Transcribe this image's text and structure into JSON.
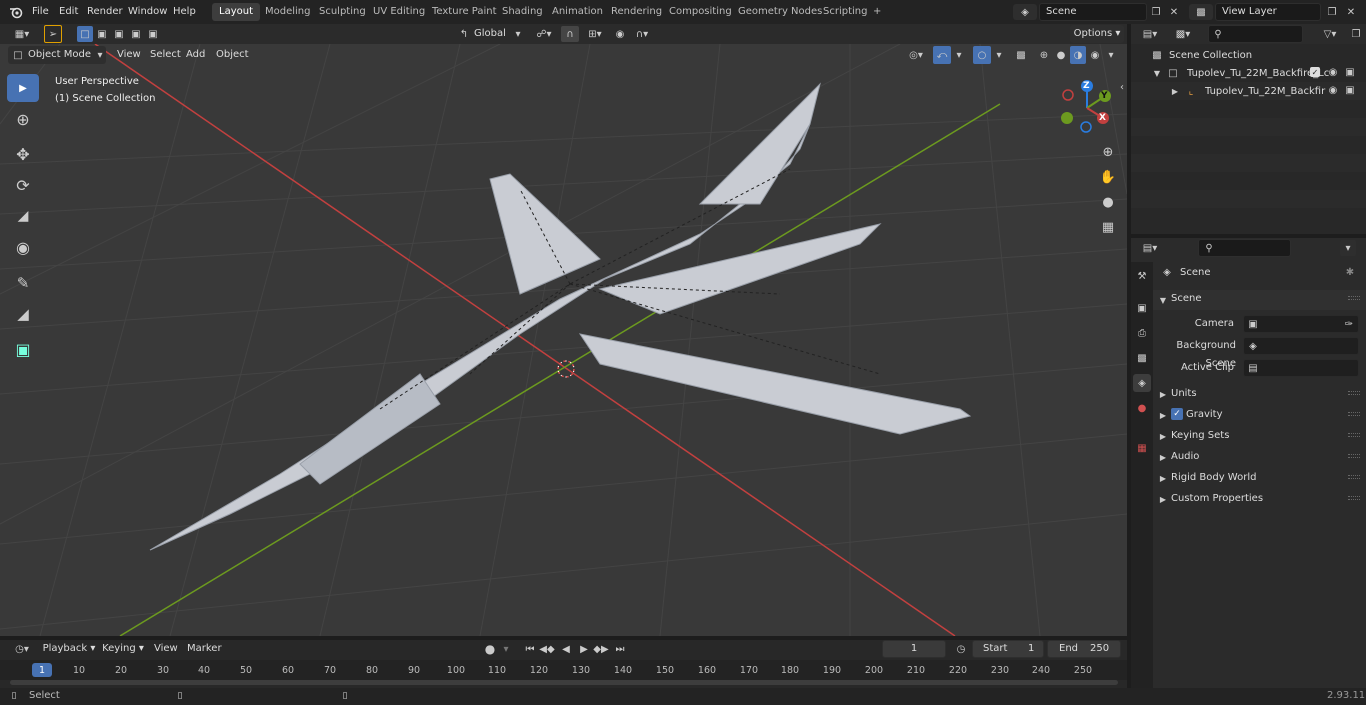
{
  "menu": [
    "File",
    "Edit",
    "Render",
    "Window",
    "Help"
  ],
  "workspaces": [
    "Layout",
    "Modeling",
    "Sculpting",
    "UV Editing",
    "Texture Paint",
    "Shading",
    "Animation",
    "Rendering",
    "Compositing",
    "Geometry Nodes",
    "Scripting"
  ],
  "scene_name": "Scene",
  "view_layer": "View Layer",
  "header": {
    "mode": "Object Mode",
    "view": "View",
    "select": "Select",
    "add": "Add",
    "object": "Object",
    "transform": "Global",
    "options": "Options"
  },
  "viewport": {
    "perspective": "User Perspective",
    "collection": "(1) Scene Collection",
    "gizmo": {
      "x": "X",
      "y": "Y",
      "z": "Z"
    }
  },
  "outliner": {
    "root": "Scene Collection",
    "collection": "Tupolev_Tu_22M_Backfire_Lc",
    "object": "Tupolev_Tu_22M_Backfir"
  },
  "properties": {
    "title": "Scene",
    "section": "Scene",
    "camera_label": "Camera",
    "bg_label": "Background Scene",
    "clip_label": "Active Clip",
    "panels": [
      "Units",
      "Gravity",
      "Keying Sets",
      "Audio",
      "Rigid Body World",
      "Custom Properties"
    ]
  },
  "timeline": {
    "playback": "Playback",
    "keying": "Keying",
    "view": "View",
    "marker": "Marker",
    "current": "1",
    "start_label": "Start",
    "start": "1",
    "end_label": "End",
    "end": "250",
    "ticks": [
      "1",
      "10",
      "20",
      "30",
      "40",
      "50",
      "60",
      "70",
      "80",
      "90",
      "100",
      "110",
      "120",
      "130",
      "140",
      "150",
      "160",
      "170",
      "180",
      "190",
      "200",
      "210",
      "220",
      "230",
      "240",
      "250"
    ]
  },
  "status": {
    "left": "Select",
    "version": "2.93.11"
  },
  "colors": {
    "accent": "#4772b3",
    "x_axis": "#c2403f",
    "y_axis": "#6c9a1f",
    "z_axis": "#2a7de1",
    "panel": "#2b2b2b",
    "viewport": "#3a3a3a"
  }
}
